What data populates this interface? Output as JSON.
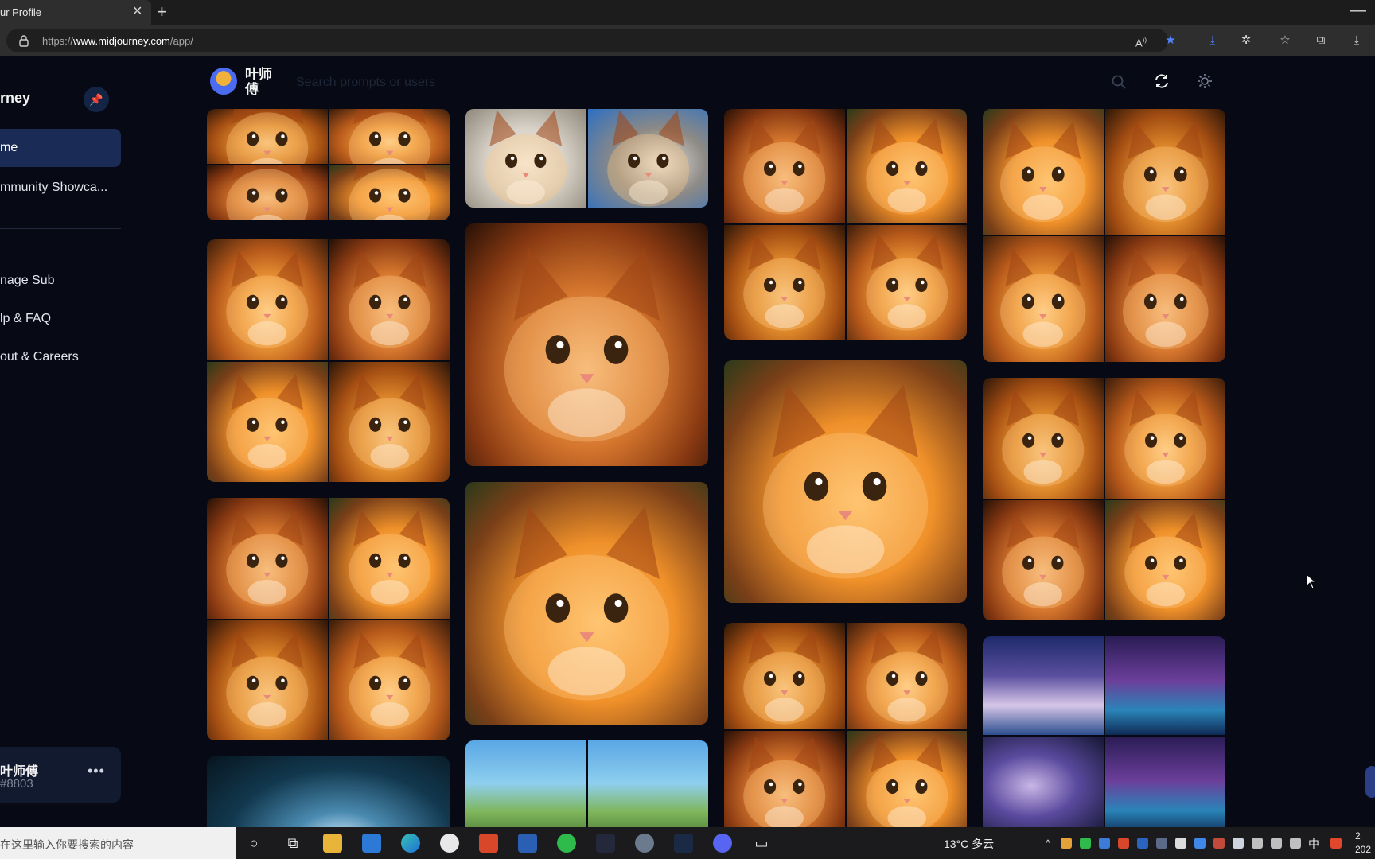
{
  "browser": {
    "tab_title": "ur Profile",
    "tab_close": "✕",
    "new_tab": "+",
    "minimize": "—",
    "url_prefix": "https://",
    "url_host": "www.midjourney.com",
    "url_path": "/app/",
    "toolbar_icons": [
      "read-aloud-icon",
      "favorite-star-icon",
      "download-icon",
      "extensions-icon",
      "favorites-icon",
      "collections-icon",
      "downloads-icon"
    ]
  },
  "sidebar": {
    "brand": "rney",
    "pin_icon": "pin-icon",
    "nav": [
      {
        "label": "me",
        "active": true
      },
      {
        "label": "mmunity Showca..."
      }
    ],
    "links": [
      {
        "label": "nage Sub"
      },
      {
        "label": "lp & FAQ"
      },
      {
        "label": "out & Careers"
      }
    ],
    "user": {
      "name": "叶师傅",
      "tag": "#8803",
      "menu": "•••"
    }
  },
  "header": {
    "name": "叶师傅",
    "search_placeholder": "Search prompts or users",
    "icons": [
      "search-icon",
      "refresh-icon",
      "theme-toggle-icon"
    ]
  },
  "feed": {
    "columns": [
      {
        "items": [
          {
            "type": "grid4",
            "theme": "orange-cat"
          },
          {
            "type": "grid4",
            "theme": "orange-cat"
          },
          {
            "type": "grid4",
            "theme": "orange-cat"
          },
          {
            "type": "single",
            "theme": "portal"
          }
        ]
      },
      {
        "items": [
          {
            "type": "grid2",
            "theme": "white-cat"
          },
          {
            "type": "single",
            "theme": "orange-cat"
          },
          {
            "type": "single",
            "theme": "orange-cat"
          },
          {
            "type": "grid2",
            "theme": "fantasy"
          }
        ]
      },
      {
        "items": [
          {
            "type": "grid4",
            "theme": "orange-cat"
          },
          {
            "type": "single",
            "theme": "orange-cat"
          },
          {
            "type": "grid4",
            "theme": "orange-cat"
          }
        ]
      },
      {
        "items": [
          {
            "type": "grid4",
            "theme": "orange-cat"
          },
          {
            "type": "grid4",
            "theme": "orange-cat"
          },
          {
            "type": "grid4",
            "theme": "boat-space"
          }
        ]
      }
    ]
  },
  "taskbar": {
    "search_text": "在这里输入你要搜索的内容",
    "weather": "13°C 多云",
    "ime": "中",
    "time": "2",
    "date": "202",
    "apps": [
      "cortana-icon",
      "task-view-icon",
      "file-explorer-icon",
      "mail-icon",
      "edge-icon",
      "app-icon",
      "office-icon",
      "word-icon",
      "wechat-icon",
      "app-icon",
      "app-icon",
      "steam-icon",
      "discord-icon",
      "camera-icon"
    ]
  },
  "colors": {
    "page_bg": "#070a14",
    "active_nav": "#1a2b55",
    "accent_blue": "#4f86ff"
  }
}
